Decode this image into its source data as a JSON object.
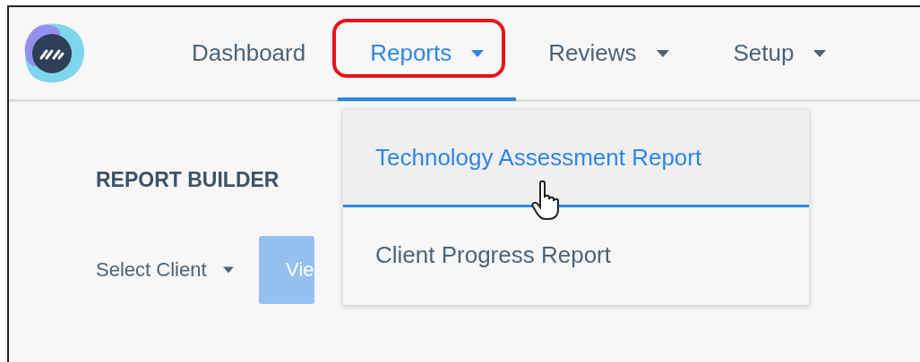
{
  "navbar": {
    "items": [
      {
        "label": "Dashboard",
        "dropdown": false,
        "selected": false,
        "highlighted": false
      },
      {
        "label": "Reports",
        "dropdown": true,
        "selected": true,
        "highlighted": true
      },
      {
        "label": "Reviews",
        "dropdown": true,
        "selected": false,
        "highlighted": false
      },
      {
        "label": "Setup",
        "dropdown": true,
        "selected": false,
        "highlighted": false
      }
    ]
  },
  "dropdown_menu": {
    "items": [
      {
        "label": "Technology Assessment Report",
        "hovered": true
      },
      {
        "label": "Client Progress Report",
        "hovered": false
      }
    ]
  },
  "page": {
    "title": "REPORT BUILDER",
    "client_select": "Select Client",
    "view_button": "Vie"
  }
}
